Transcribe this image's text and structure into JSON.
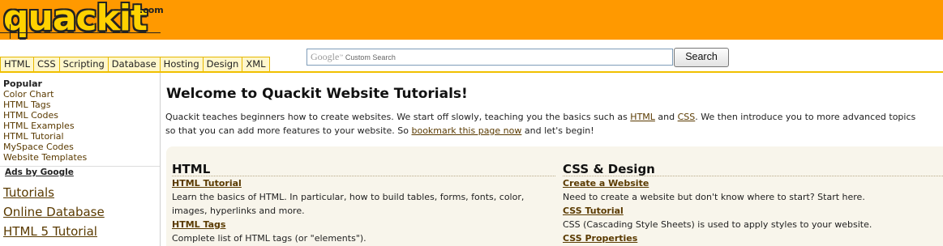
{
  "logo": {
    "text": "quackit",
    "dotcom": ".com"
  },
  "topnav": [
    "HTML",
    "CSS",
    "Scripting",
    "Database",
    "Hosting",
    "Design",
    "XML"
  ],
  "search": {
    "brand": "Google",
    "placeholder": "Custom Search",
    "button": "Search"
  },
  "sidebar": {
    "heading": "Popular",
    "links": [
      "Color Chart",
      "HTML Tags",
      "HTML Codes",
      "HTML Examples",
      "HTML Tutorial",
      "MySpace Codes",
      "Website Templates"
    ],
    "ads_label": "Ads by Google",
    "ads": [
      "Tutorials",
      "Online Database",
      "HTML 5 Tutorial"
    ]
  },
  "main": {
    "title": "Welcome to Quackit Website Tutorials!",
    "intro": {
      "p1": "Quackit teaches beginners how to create websites. We start off slowly, teaching you the basics such as ",
      "link_html": "HTML",
      "and": " and ",
      "link_css": "CSS",
      "p2": ". We then introduce you to more advanced topics",
      "p3": "so that you can add more features to your website. So ",
      "link_bookmark": "bookmark this page now",
      "p4": " and let's begin!"
    },
    "columns": [
      {
        "title": "HTML",
        "items": [
          {
            "link": "HTML Tutorial",
            "desc1": "Learn the basics of HTML. In particular, how to build tables, forms, fonts, color,",
            "desc2": "images, hyperlinks and more."
          },
          {
            "link": "HTML Tags",
            "desc1": "Complete list of HTML tags (or \"elements\").",
            "desc2": ""
          }
        ]
      },
      {
        "title": "CSS & Design",
        "items": [
          {
            "link": "Create a Website",
            "desc1": "Need to create a website but don't know where to start? Start here.",
            "desc2": ""
          },
          {
            "link": "CSS Tutorial",
            "desc1": "CSS (Cascading Style Sheets) is used to apply styles to your website.",
            "desc2": ""
          },
          {
            "link": "CSS Properties",
            "desc1": "",
            "desc2": ""
          }
        ]
      }
    ]
  },
  "colors": {
    "header": "#ff9900",
    "link": "#5a3a00",
    "panel": "#f8f5eb",
    "nav_tab": "#fff7cc"
  }
}
